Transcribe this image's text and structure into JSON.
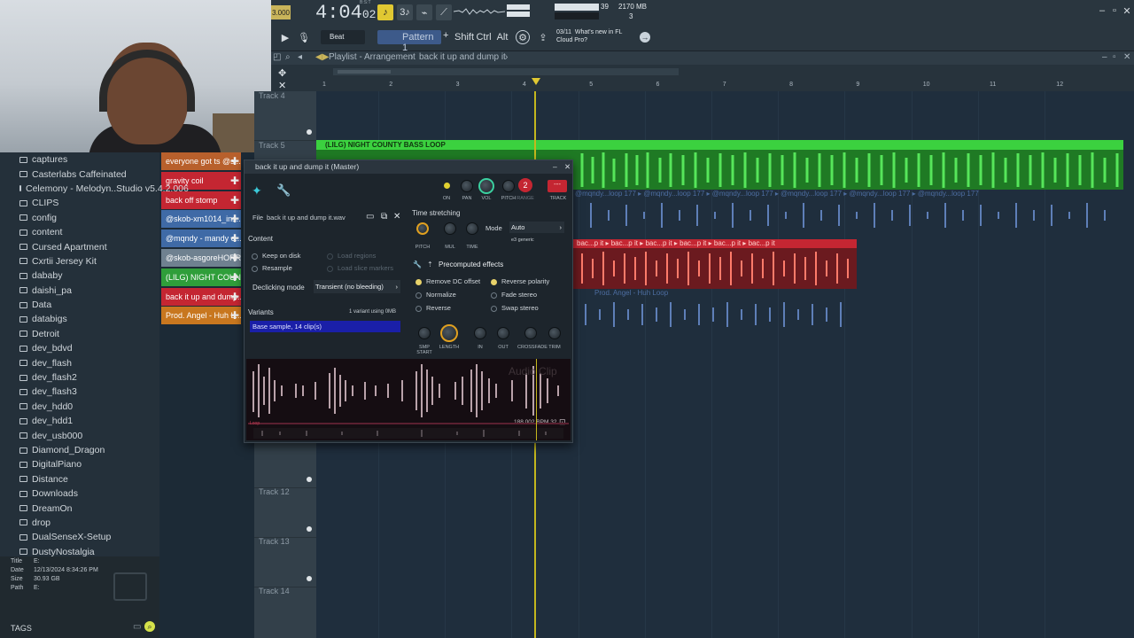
{
  "topbar": {
    "time": "4:04",
    "time_frames": "02",
    "time_unit": "B:S:T",
    "tempo": "3.000",
    "beat_label": "Beat",
    "pattern": "Pattern 1",
    "mod_keys": [
      "Shift",
      "Ctrl",
      "Alt"
    ],
    "cpu": "39",
    "mem": "2170 MB",
    "polyphony": "3",
    "news_date": "03/11",
    "news_text_1": "What's new in FL",
    "news_text_2": "Cloud Pro?"
  },
  "playlist": {
    "breadcrumb_1": "Playlist - Arrangement",
    "breadcrumb_2": "back it up and dump it",
    "bars": [
      "1",
      "2",
      "3",
      "4",
      "5",
      "6",
      "7",
      "8",
      "9",
      "10",
      "11",
      "12"
    ],
    "tracks": [
      "Track 4",
      "Track 5",
      "Track 12",
      "Track 13",
      "Track 14"
    ],
    "clips": {
      "bass_loop": "(LILG) NIGHT COUNTY BASS LOOP",
      "mqndy": "@mqndy...loop 177",
      "back": "bac...p it",
      "angel": "Prod. Angel - Huh Loop"
    }
  },
  "channels": [
    {
      "label": "everyone got ts @sl...",
      "color": "#b8602c"
    },
    {
      "label": "gravity coil",
      "color": "#c42632"
    },
    {
      "label": "back off stomp",
      "color": "#c42632"
    },
    {
      "label": "@skob-xm1014_ins...",
      "color": "#3f6aa6"
    },
    {
      "label": "@mqndy - mandy c...",
      "color": "#3f6aa6"
    },
    {
      "label": "@skob-asgoreHORR...",
      "color": "#6f8190"
    },
    {
      "label": "(LILG) NIGHT COUNTY...",
      "color": "#2f9e3a"
    },
    {
      "label": "back it up and dump...",
      "color": "#c42632"
    },
    {
      "label": "Prod. Angel - Huh L...",
      "color": "#c8771f"
    }
  ],
  "browser": {
    "items": [
      "captures",
      "Casterlabs Caffeinated",
      "Celemony - Melodyn..Studio v5.4.2.006",
      "CLIPS",
      "config",
      "content",
      "Cursed Apartment",
      "Cxrtii Jersey Kit",
      "dababy",
      "daishi_pa",
      "Data",
      "databigs",
      "Detroit",
      "dev_bdvd",
      "dev_flash",
      "dev_flash2",
      "dev_flash3",
      "dev_hdd0",
      "dev_hdd1",
      "dev_usb000",
      "Diamond_Dragon",
      "DigitalPiano",
      "Distance",
      "Downloads",
      "DreamOn",
      "drop",
      "DualSenseX-Setup",
      "DustyNostalgia"
    ],
    "info_title_label": "Title",
    "info_title": "E:",
    "info_date_label": "Date",
    "info_date": "12/13/2024 8:34:26 PM",
    "info_size_label": "Size",
    "info_size": "30.93 GB",
    "info_path_label": "Path",
    "info_path": "E:",
    "tags_label": "TAGS"
  },
  "dialog": {
    "title": "back it up and dump it",
    "title_suffix": "(Master)",
    "file_label": "File",
    "file_name": "back it up and dump it.wav",
    "content_label": "Content",
    "keep_on_disk": "Keep on disk",
    "resample": "Resample",
    "load_regions": "Load regions",
    "load_slice_markers": "Load slice markers",
    "declicking_label": "Declicking mode",
    "declicking_value": "Transient (no bleeding)",
    "variants_label": "Variants",
    "variants_info": "1 variant using 0MB",
    "variant_item": "Base sample, 14 clip(s)",
    "time_stretching": "Time stretching",
    "mode_label": "Mode",
    "mode_value": "Auto",
    "mode_sub": "e3 generic",
    "knobs_top": [
      "ON",
      "PAN",
      "VOL",
      "PITCH",
      "RANGE",
      "TRACK"
    ],
    "range_value": "2",
    "ts_knobs": [
      "PITCH",
      "MUL",
      "TIME"
    ],
    "precomputed": "Precomputed effects",
    "remove_dc": "Remove DC offset",
    "normalize": "Normalize",
    "reverse": "Reverse",
    "reverse_polarity": "Reverse polarity",
    "fade_stereo": "Fade stereo",
    "swap_stereo": "Swap stereo",
    "fx_knobs": [
      "SMP START",
      "LENGTH",
      "IN",
      "OUT",
      "CROSSFADE",
      "TRIM"
    ],
    "watermark": "Audio Clip",
    "bpm": "188.002 BPM",
    "bpm_extra": "32",
    "loop_label": "Loop"
  },
  "colors": {
    "bass_green": "#3bd13f",
    "bass_dark": "#1f7a24",
    "blue_wave": "#5e7fb8",
    "red_clip": "#ff7b6a",
    "red_header": "#c42632",
    "variant_sel": "#1a1fa8",
    "playhead": "#c4b71e"
  }
}
